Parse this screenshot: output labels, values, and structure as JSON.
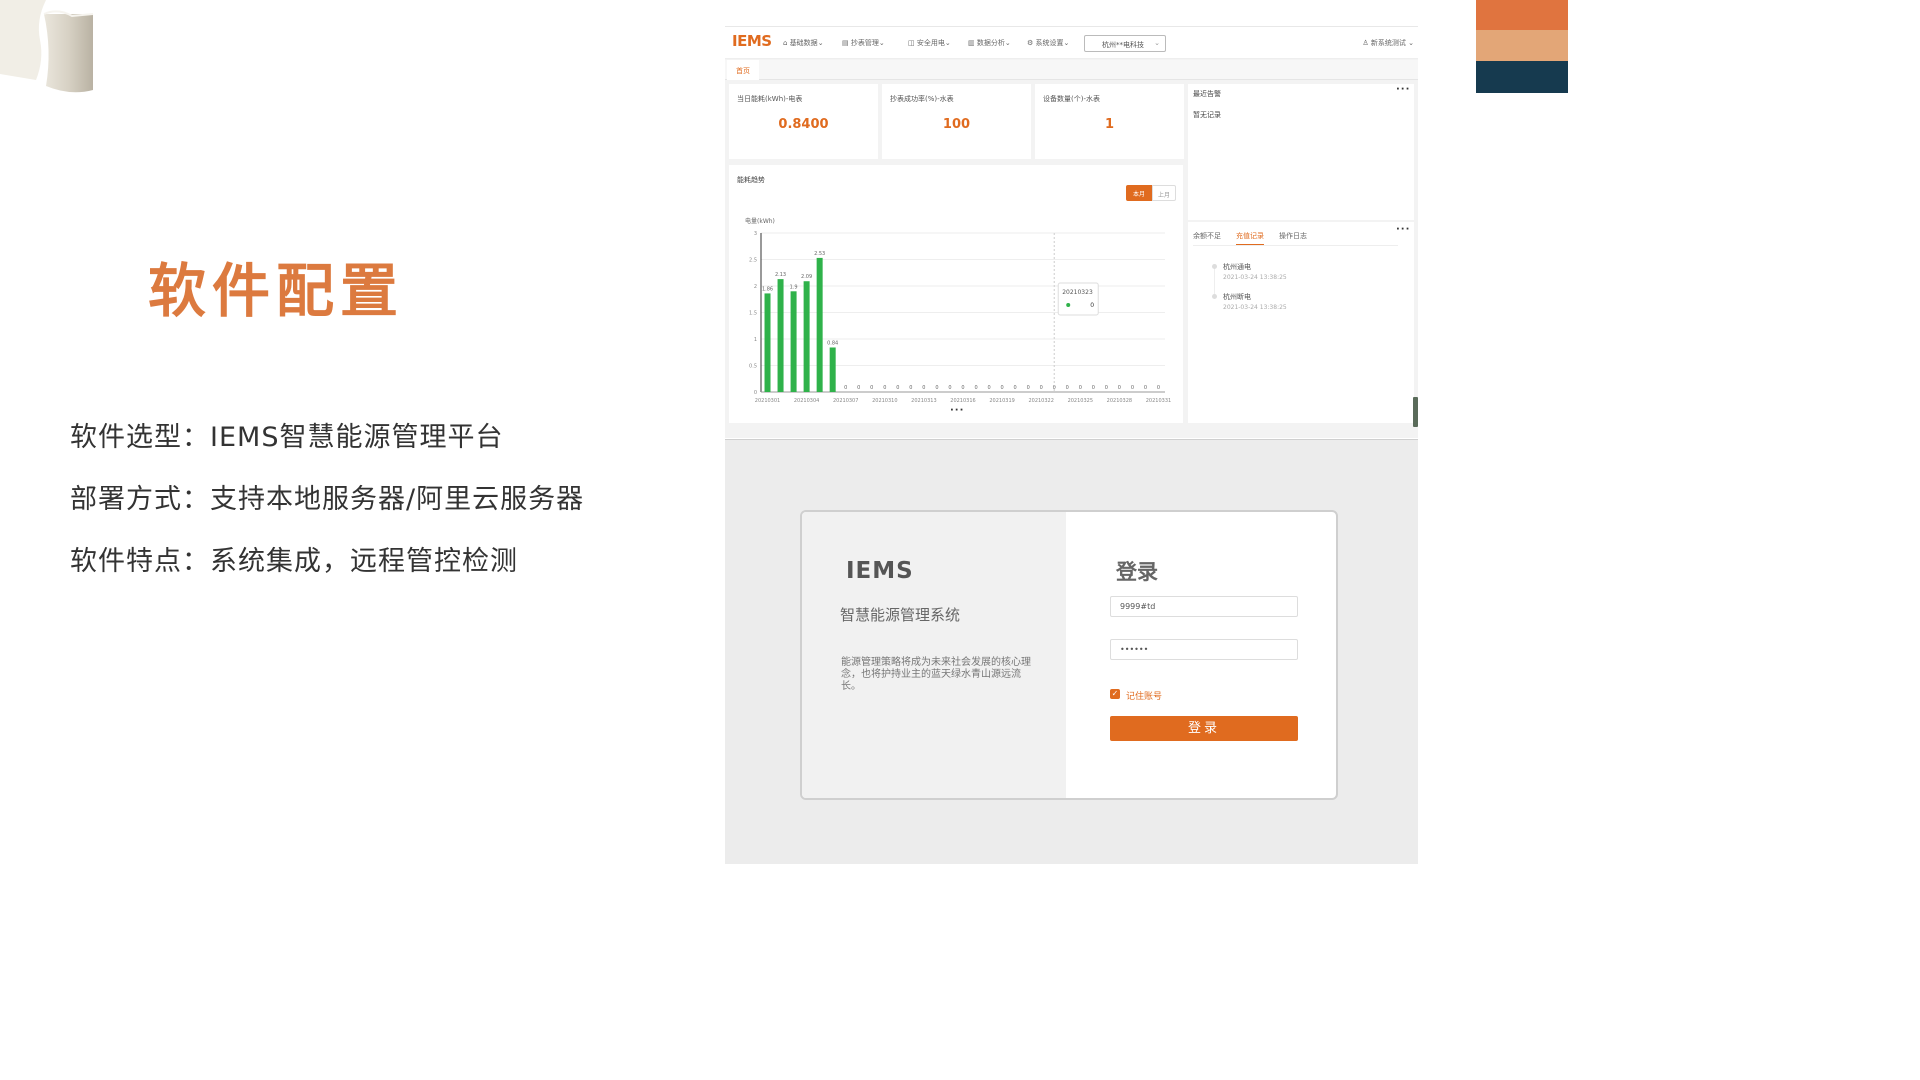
{
  "colors": {
    "accent": "#e06b1f",
    "bar_top": "#e0743f",
    "bar_mid": "#e3a677",
    "bar_bottom": "#163a4f",
    "title_orange": "#dc7a3f",
    "chart_green": "#2fb24a"
  },
  "slide": {
    "title": "软件配置",
    "points": [
      "软件选型：IEMS智慧能源管理平台",
      "部署方式：支持本地服务器/阿里云服务器",
      "软件特点：系统集成，远程管控检测"
    ]
  },
  "dashboard": {
    "logo": "IEMS",
    "nav": [
      "基础数据",
      "抄表管理",
      "安全用电",
      "数据分析",
      "系统设置"
    ],
    "nav_icons": [
      "home-icon",
      "receipt-icon",
      "shield-icon",
      "bar-chart-icon",
      "gear-icon"
    ],
    "company": "杭州**电科技",
    "user": "新系统测试",
    "home_tab": "首页",
    "stats": [
      {
        "label": "当日能耗(kWh)-电表",
        "value": "0.8400"
      },
      {
        "label": "抄表成功率(%)-水表",
        "value": "100"
      },
      {
        "label": "设备数量(个)-水表",
        "value": "1"
      }
    ],
    "alarm_title": "最近告警",
    "alarm_empty": "暂无记录",
    "record_tabs": [
      "余额不足",
      "充值记录",
      "操作日志"
    ],
    "records": [
      {
        "name": "杭州通电",
        "time": "2021-03-24 13:38:25"
      },
      {
        "name": "杭州断电",
        "time": "2021-03-24 13:38:25"
      }
    ],
    "tooltip": {
      "date": "20210323",
      "value": "0"
    }
  },
  "chart_data": {
    "type": "bar",
    "title": "能耗趋势",
    "ylabel": "电量(kWh)",
    "toggle": [
      "本月",
      "上月"
    ],
    "ylim": [
      0,
      3
    ],
    "yticks": [
      "0",
      "0.5",
      "1",
      "1.5",
      "2",
      "2.5",
      "3"
    ],
    "xtick_labels": [
      "20210301",
      "20210304",
      "20210307",
      "20210310",
      "20210313",
      "20210316",
      "20210319",
      "20210322",
      "20210325",
      "20210328",
      "20210331"
    ],
    "categories": [
      "20210301",
      "20210302",
      "20210303",
      "20210304",
      "20210305",
      "20210306",
      "20210307",
      "20210308",
      "20210309",
      "20210310",
      "20210311",
      "20210312",
      "20210313",
      "20210314",
      "20210315",
      "20210316",
      "20210317",
      "20210318",
      "20210319",
      "20210320",
      "20210321",
      "20210322",
      "20210323",
      "20210324",
      "20210325",
      "20210326",
      "20210327",
      "20210328",
      "20210329",
      "20210330",
      "20210331"
    ],
    "values": [
      1.86,
      2.13,
      1.9,
      2.09,
      2.53,
      0.84,
      0,
      0,
      0,
      0,
      0,
      0,
      0,
      0,
      0,
      0,
      0,
      0,
      0,
      0,
      0,
      0,
      0,
      0,
      0,
      0,
      0,
      0,
      0,
      0,
      0
    ]
  },
  "login": {
    "brand": "IEMS",
    "subtitle": "智慧能源管理系统",
    "description": "能源管理策略将成为未来社会发展的核心理念，也将护持业主的蓝天绿水青山源远流长。",
    "title": "登录",
    "username": "9999#td",
    "password": "••••••",
    "remember": "记住账号",
    "button": "登录"
  }
}
